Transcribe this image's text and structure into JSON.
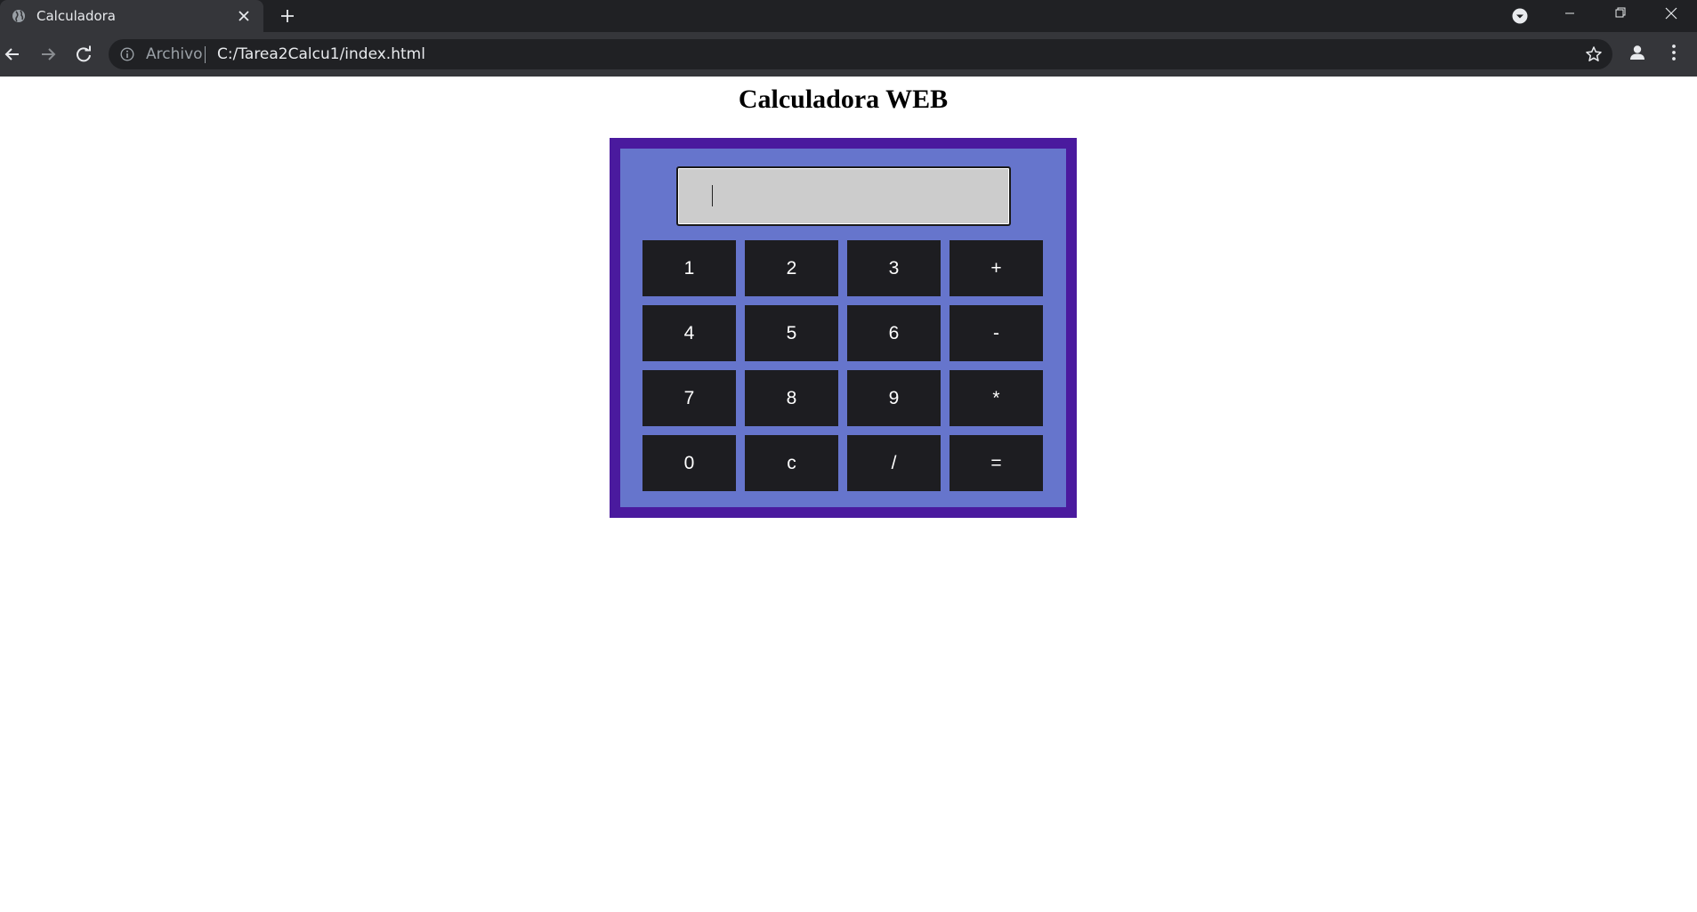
{
  "browser": {
    "tab_title": "Calculadora",
    "scheme_label": "Archivo",
    "url": "C:/Tarea2Calcu1/index.html"
  },
  "page": {
    "title": "Calculadora WEB",
    "display_value": ""
  },
  "keys": [
    {
      "label": "1",
      "name": "key-1"
    },
    {
      "label": "2",
      "name": "key-2"
    },
    {
      "label": "3",
      "name": "key-3"
    },
    {
      "label": "+",
      "name": "key-plus"
    },
    {
      "label": "4",
      "name": "key-4"
    },
    {
      "label": "5",
      "name": "key-5"
    },
    {
      "label": "6",
      "name": "key-6"
    },
    {
      "label": "-",
      "name": "key-minus"
    },
    {
      "label": "7",
      "name": "key-7"
    },
    {
      "label": "8",
      "name": "key-8"
    },
    {
      "label": "9",
      "name": "key-9"
    },
    {
      "label": "*",
      "name": "key-multiply"
    },
    {
      "label": "0",
      "name": "key-0"
    },
    {
      "label": "c",
      "name": "key-clear"
    },
    {
      "label": "/",
      "name": "key-divide"
    },
    {
      "label": "=",
      "name": "key-equals"
    }
  ],
  "colors": {
    "chrome_dark": "#202124",
    "chrome_toolbar": "#35363a",
    "calc_border": "#4a1a9e",
    "calc_background": "#6675cc",
    "key_background": "#1d1d21",
    "display_background": "#cccccc"
  },
  "icons": [
    "globe-icon",
    "close-icon",
    "plus-icon",
    "tab-search-icon",
    "minimize-icon",
    "restore-icon",
    "window-close-icon",
    "back-arrow-icon",
    "forward-arrow-icon",
    "reload-icon",
    "info-icon",
    "star-icon",
    "profile-icon",
    "kebab-menu-icon"
  ]
}
